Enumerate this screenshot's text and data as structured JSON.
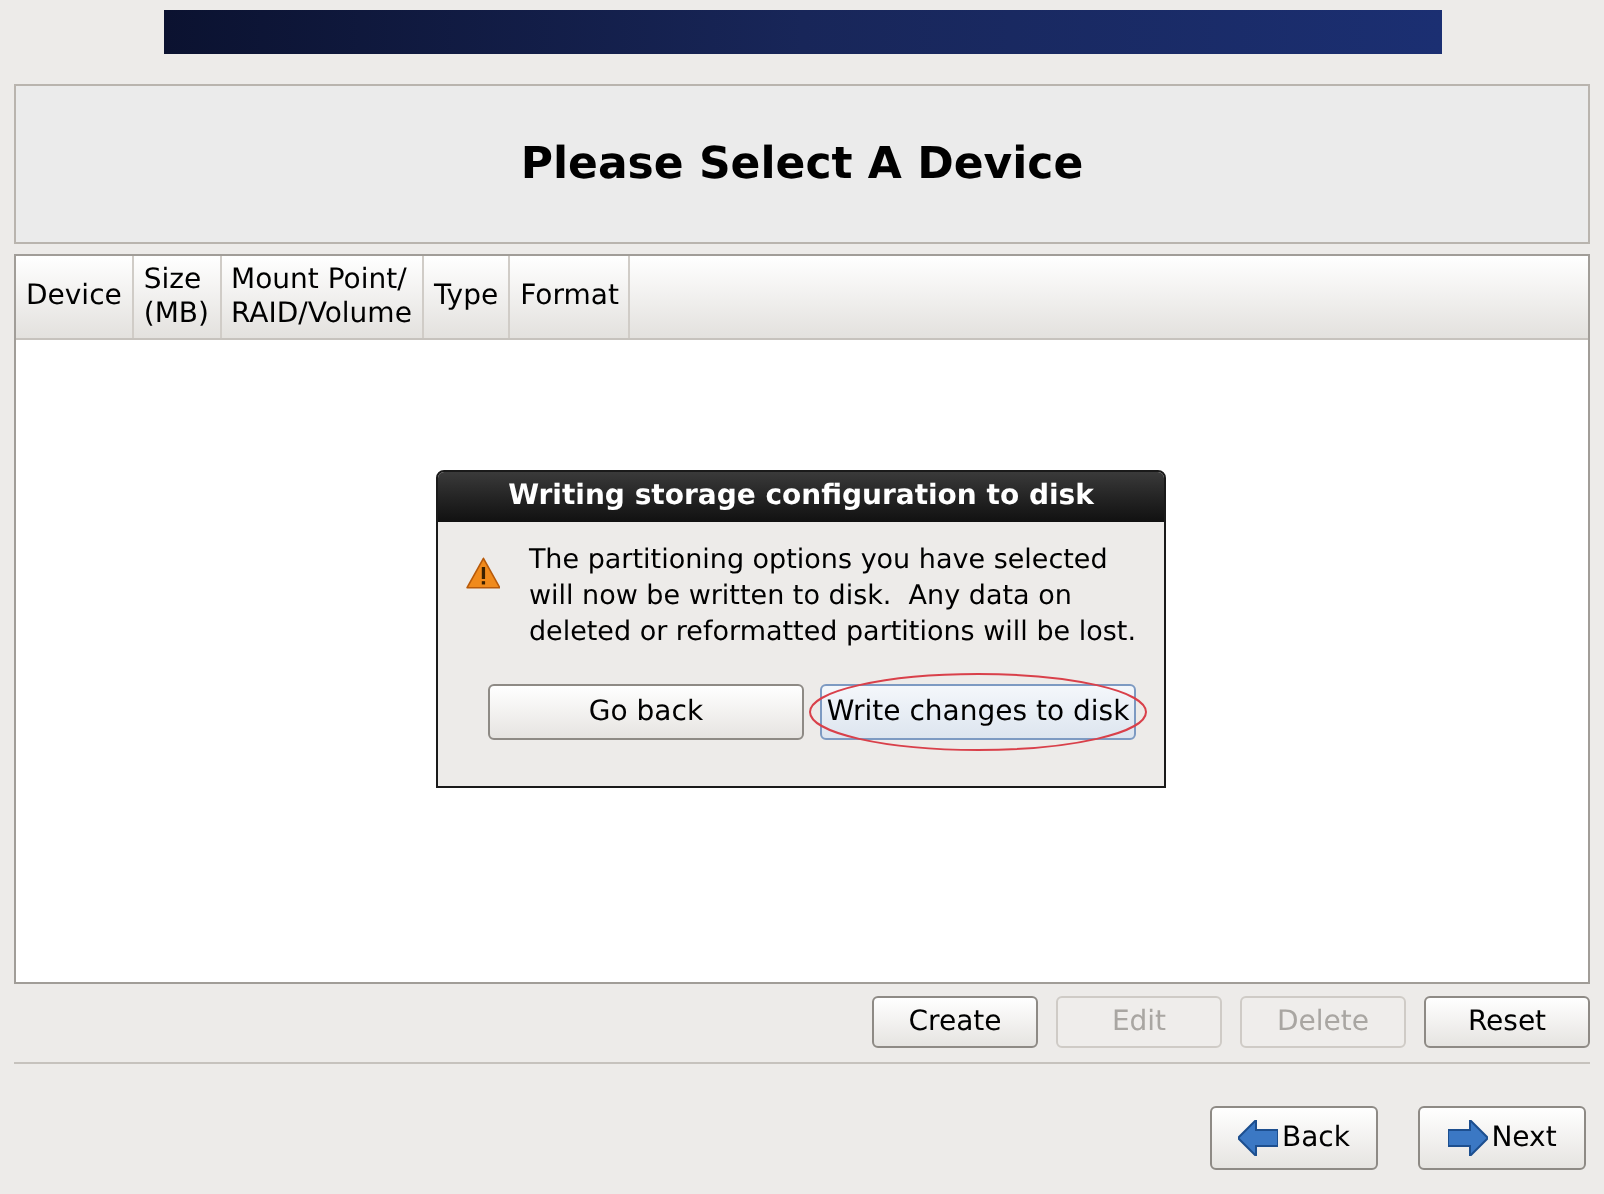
{
  "header": {
    "title": "Please Select A Device"
  },
  "table": {
    "columns": [
      "Device",
      "Size\n(MB)",
      "Mount Point/\nRAID/Volume",
      "Type",
      "Format"
    ]
  },
  "dialog": {
    "title": "Writing storage configuration to disk",
    "message": "The partitioning options you have selected\nwill now be written to disk.  Any data on\ndeleted or reformatted partitions will be lost.",
    "buttons": [
      {
        "label": "Go back",
        "focused": false,
        "circled": false
      },
      {
        "label": "Write changes to disk",
        "focused": true,
        "circled": true
      }
    ]
  },
  "actions": [
    {
      "label": "Create",
      "disabled": false
    },
    {
      "label": "Edit",
      "disabled": true
    },
    {
      "label": "Delete",
      "disabled": true
    },
    {
      "label": "Reset",
      "disabled": false
    }
  ],
  "nav": [
    {
      "label": "Back",
      "kind": "back"
    },
    {
      "label": "Next",
      "kind": "next"
    }
  ]
}
